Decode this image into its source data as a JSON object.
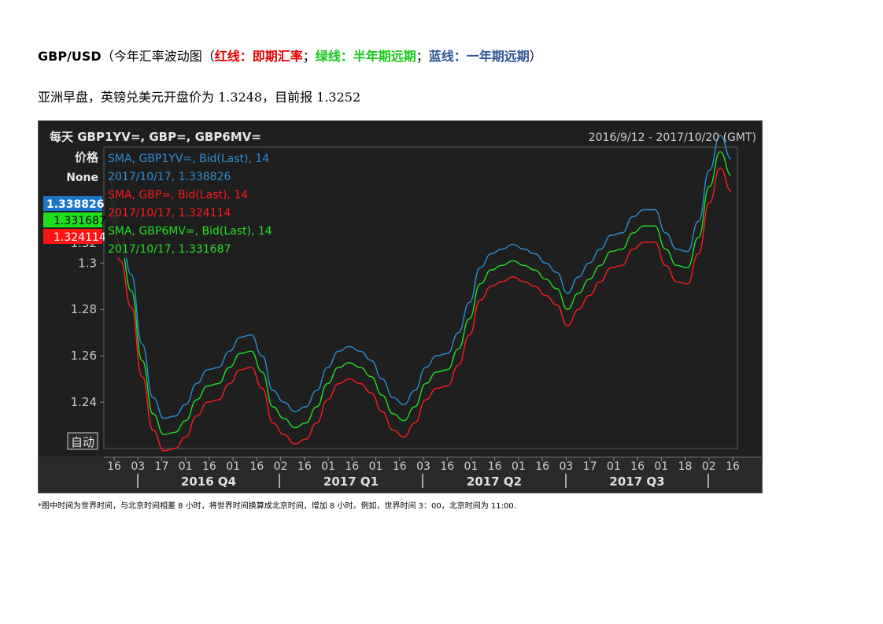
{
  "heading": {
    "pair": "GBP/USD",
    "desc_open": "（今年汇率波动图（",
    "red_text": "红线：即期汇率",
    "sep1": "；",
    "green_text": "绿线：半年期远期",
    "sep2": "；",
    "blue_text": "蓝线：一年期远期",
    "close": "）"
  },
  "subline": "亚洲早盘，英镑兑美元开盘价为 1.3248，目前报 1.3252",
  "footnote": "*图中时间为世界时间，与北京时间相差 8 小时，将世界时间换算成北京时间，增加 8 小时。例如，世界时间 3：00，北京时间为 11:00.",
  "colors": {
    "background": "#1f1f1f",
    "blue": "#2b8fd6",
    "red": "#ff1c1c",
    "green": "#22e022"
  },
  "chart_data": {
    "type": "line",
    "title": "每天 GBP1YV=, GBP=, GBP6MV=",
    "date_range": "2016/9/12 - 2017/10/20 (GMT)",
    "price_label": "价格",
    "none_label": "None",
    "auto_label": "自动",
    "ylim": [
      1.22,
      1.35
    ],
    "y_ticks": [
      "1.3",
      "1.28",
      "1.26",
      "1.24"
    ],
    "y_tick_values": [
      1.3,
      1.28,
      1.26,
      1.24
    ],
    "partial_tick": "1.32",
    "x_ticks": [
      "16",
      "03",
      "17",
      "01",
      "16",
      "01",
      "16",
      "02",
      "16",
      "01",
      "16",
      "01",
      "16",
      "03",
      "16",
      "01",
      "16",
      "01",
      "16",
      "03",
      "17",
      "01",
      "16",
      "01",
      "18",
      "02",
      "16"
    ],
    "quarters": [
      "2016 Q4",
      "2017 Q1",
      "2017 Q2",
      "2017 Q3"
    ],
    "badges": [
      "1.338826",
      "1.331687",
      "1.324114"
    ],
    "legend": [
      {
        "series": "SMA, GBP1YV=, Bid(Last),  14",
        "value": "2017/10/17, 1.338826"
      },
      {
        "series": "SMA, GBP=, Bid(Last),  14",
        "value": "2017/10/17, 1.324114"
      },
      {
        "series": "SMA, GBP6MV=, Bid(Last),  14",
        "value": "2017/10/17, 1.331687"
      }
    ],
    "x": [
      "2016-09-12",
      "2016-09-19",
      "2016-09-26",
      "2016-10-03",
      "2016-10-10",
      "2016-10-17",
      "2016-10-24",
      "2016-10-31",
      "2016-11-07",
      "2016-11-14",
      "2016-11-21",
      "2016-11-28",
      "2016-12-05",
      "2016-12-12",
      "2016-12-19",
      "2016-12-26",
      "2017-01-02",
      "2017-01-09",
      "2017-01-16",
      "2017-01-23",
      "2017-01-30",
      "2017-02-06",
      "2017-02-13",
      "2017-02-20",
      "2017-02-27",
      "2017-03-06",
      "2017-03-13",
      "2017-03-20",
      "2017-03-27",
      "2017-04-03",
      "2017-04-10",
      "2017-04-17",
      "2017-04-24",
      "2017-05-01",
      "2017-05-08",
      "2017-05-15",
      "2017-05-22",
      "2017-05-29",
      "2017-06-05",
      "2017-06-12",
      "2017-06-19",
      "2017-06-26",
      "2017-07-03",
      "2017-07-10",
      "2017-07-17",
      "2017-07-24",
      "2017-07-31",
      "2017-08-07",
      "2017-08-14",
      "2017-08-21",
      "2017-08-28",
      "2017-09-04",
      "2017-09-11",
      "2017-09-18",
      "2017-09-25",
      "2017-10-02",
      "2017-10-09",
      "2017-10-17"
    ],
    "series": [
      {
        "name": "GBP1YV=",
        "color": "#2b8fd6",
        "values": [
          1.335,
          1.315,
          1.295,
          1.265,
          1.242,
          1.233,
          1.234,
          1.239,
          1.248,
          1.254,
          1.255,
          1.262,
          1.268,
          1.269,
          1.26,
          1.245,
          1.24,
          1.236,
          1.238,
          1.245,
          1.255,
          1.262,
          1.264,
          1.262,
          1.258,
          1.25,
          1.242,
          1.239,
          1.245,
          1.255,
          1.26,
          1.261,
          1.27,
          1.283,
          1.298,
          1.304,
          1.306,
          1.308,
          1.306,
          1.304,
          1.3,
          1.296,
          1.287,
          1.294,
          1.3,
          1.306,
          1.312,
          1.313,
          1.32,
          1.323,
          1.323,
          1.313,
          1.306,
          1.305,
          1.318,
          1.34,
          1.355,
          1.345
        ]
      },
      {
        "name": "GBP6MV=",
        "color": "#22e022",
        "values": [
          1.328,
          1.308,
          1.288,
          1.258,
          1.235,
          1.226,
          1.227,
          1.232,
          1.241,
          1.247,
          1.248,
          1.255,
          1.261,
          1.262,
          1.253,
          1.238,
          1.233,
          1.229,
          1.231,
          1.238,
          1.248,
          1.255,
          1.257,
          1.255,
          1.251,
          1.243,
          1.235,
          1.232,
          1.238,
          1.248,
          1.253,
          1.254,
          1.263,
          1.276,
          1.291,
          1.297,
          1.299,
          1.301,
          1.299,
          1.297,
          1.293,
          1.289,
          1.28,
          1.287,
          1.293,
          1.299,
          1.305,
          1.306,
          1.313,
          1.316,
          1.316,
          1.306,
          1.299,
          1.298,
          1.311,
          1.333,
          1.348,
          1.338
        ]
      },
      {
        "name": "GBP=",
        "color": "#ff1c1c",
        "values": [
          1.321,
          1.301,
          1.281,
          1.251,
          1.228,
          1.219,
          1.22,
          1.225,
          1.234,
          1.24,
          1.241,
          1.248,
          1.254,
          1.255,
          1.246,
          1.231,
          1.226,
          1.222,
          1.224,
          1.231,
          1.241,
          1.248,
          1.25,
          1.248,
          1.244,
          1.236,
          1.228,
          1.225,
          1.231,
          1.241,
          1.246,
          1.247,
          1.256,
          1.269,
          1.284,
          1.29,
          1.292,
          1.294,
          1.292,
          1.29,
          1.286,
          1.282,
          1.273,
          1.28,
          1.286,
          1.292,
          1.298,
          1.299,
          1.306,
          1.309,
          1.309,
          1.299,
          1.292,
          1.291,
          1.304,
          1.326,
          1.341,
          1.331
        ]
      }
    ]
  }
}
